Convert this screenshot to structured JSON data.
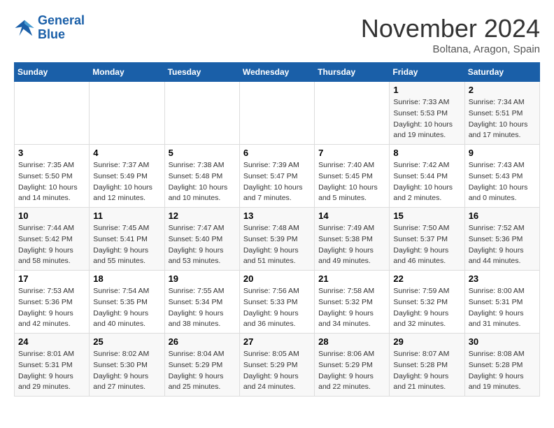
{
  "logo": {
    "line1": "General",
    "line2": "Blue"
  },
  "title": "November 2024",
  "location": "Boltana, Aragon, Spain",
  "days_of_week": [
    "Sunday",
    "Monday",
    "Tuesday",
    "Wednesday",
    "Thursday",
    "Friday",
    "Saturday"
  ],
  "weeks": [
    [
      {
        "day": "",
        "info": ""
      },
      {
        "day": "",
        "info": ""
      },
      {
        "day": "",
        "info": ""
      },
      {
        "day": "",
        "info": ""
      },
      {
        "day": "",
        "info": ""
      },
      {
        "day": "1",
        "info": "Sunrise: 7:33 AM\nSunset: 5:53 PM\nDaylight: 10 hours and 19 minutes."
      },
      {
        "day": "2",
        "info": "Sunrise: 7:34 AM\nSunset: 5:51 PM\nDaylight: 10 hours and 17 minutes."
      }
    ],
    [
      {
        "day": "3",
        "info": "Sunrise: 7:35 AM\nSunset: 5:50 PM\nDaylight: 10 hours and 14 minutes."
      },
      {
        "day": "4",
        "info": "Sunrise: 7:37 AM\nSunset: 5:49 PM\nDaylight: 10 hours and 12 minutes."
      },
      {
        "day": "5",
        "info": "Sunrise: 7:38 AM\nSunset: 5:48 PM\nDaylight: 10 hours and 10 minutes."
      },
      {
        "day": "6",
        "info": "Sunrise: 7:39 AM\nSunset: 5:47 PM\nDaylight: 10 hours and 7 minutes."
      },
      {
        "day": "7",
        "info": "Sunrise: 7:40 AM\nSunset: 5:45 PM\nDaylight: 10 hours and 5 minutes."
      },
      {
        "day": "8",
        "info": "Sunrise: 7:42 AM\nSunset: 5:44 PM\nDaylight: 10 hours and 2 minutes."
      },
      {
        "day": "9",
        "info": "Sunrise: 7:43 AM\nSunset: 5:43 PM\nDaylight: 10 hours and 0 minutes."
      }
    ],
    [
      {
        "day": "10",
        "info": "Sunrise: 7:44 AM\nSunset: 5:42 PM\nDaylight: 9 hours and 58 minutes."
      },
      {
        "day": "11",
        "info": "Sunrise: 7:45 AM\nSunset: 5:41 PM\nDaylight: 9 hours and 55 minutes."
      },
      {
        "day": "12",
        "info": "Sunrise: 7:47 AM\nSunset: 5:40 PM\nDaylight: 9 hours and 53 minutes."
      },
      {
        "day": "13",
        "info": "Sunrise: 7:48 AM\nSunset: 5:39 PM\nDaylight: 9 hours and 51 minutes."
      },
      {
        "day": "14",
        "info": "Sunrise: 7:49 AM\nSunset: 5:38 PM\nDaylight: 9 hours and 49 minutes."
      },
      {
        "day": "15",
        "info": "Sunrise: 7:50 AM\nSunset: 5:37 PM\nDaylight: 9 hours and 46 minutes."
      },
      {
        "day": "16",
        "info": "Sunrise: 7:52 AM\nSunset: 5:36 PM\nDaylight: 9 hours and 44 minutes."
      }
    ],
    [
      {
        "day": "17",
        "info": "Sunrise: 7:53 AM\nSunset: 5:36 PM\nDaylight: 9 hours and 42 minutes."
      },
      {
        "day": "18",
        "info": "Sunrise: 7:54 AM\nSunset: 5:35 PM\nDaylight: 9 hours and 40 minutes."
      },
      {
        "day": "19",
        "info": "Sunrise: 7:55 AM\nSunset: 5:34 PM\nDaylight: 9 hours and 38 minutes."
      },
      {
        "day": "20",
        "info": "Sunrise: 7:56 AM\nSunset: 5:33 PM\nDaylight: 9 hours and 36 minutes."
      },
      {
        "day": "21",
        "info": "Sunrise: 7:58 AM\nSunset: 5:32 PM\nDaylight: 9 hours and 34 minutes."
      },
      {
        "day": "22",
        "info": "Sunrise: 7:59 AM\nSunset: 5:32 PM\nDaylight: 9 hours and 32 minutes."
      },
      {
        "day": "23",
        "info": "Sunrise: 8:00 AM\nSunset: 5:31 PM\nDaylight: 9 hours and 31 minutes."
      }
    ],
    [
      {
        "day": "24",
        "info": "Sunrise: 8:01 AM\nSunset: 5:31 PM\nDaylight: 9 hours and 29 minutes."
      },
      {
        "day": "25",
        "info": "Sunrise: 8:02 AM\nSunset: 5:30 PM\nDaylight: 9 hours and 27 minutes."
      },
      {
        "day": "26",
        "info": "Sunrise: 8:04 AM\nSunset: 5:29 PM\nDaylight: 9 hours and 25 minutes."
      },
      {
        "day": "27",
        "info": "Sunrise: 8:05 AM\nSunset: 5:29 PM\nDaylight: 9 hours and 24 minutes."
      },
      {
        "day": "28",
        "info": "Sunrise: 8:06 AM\nSunset: 5:29 PM\nDaylight: 9 hours and 22 minutes."
      },
      {
        "day": "29",
        "info": "Sunrise: 8:07 AM\nSunset: 5:28 PM\nDaylight: 9 hours and 21 minutes."
      },
      {
        "day": "30",
        "info": "Sunrise: 8:08 AM\nSunset: 5:28 PM\nDaylight: 9 hours and 19 minutes."
      }
    ]
  ]
}
